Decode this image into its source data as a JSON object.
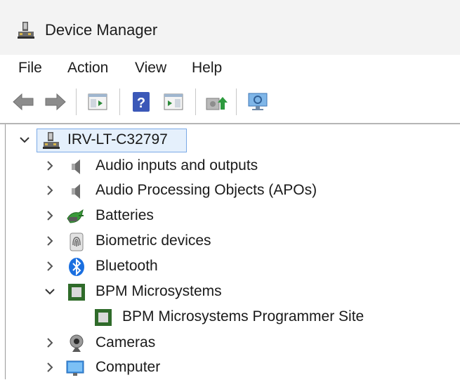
{
  "window": {
    "title": "Device Manager"
  },
  "menu": [
    "File",
    "Action",
    "View",
    "Help"
  ],
  "toolbar": {
    "icons": [
      "back-arrow-icon",
      "forward-arrow-icon",
      "show-hide-console-tree-icon",
      "help-icon",
      "action-pane-icon",
      "update-driver-icon",
      "scan-hardware-changes-icon"
    ]
  },
  "tree": {
    "root": {
      "label": "IRV-LT-C32797",
      "expanded": true,
      "selected": true
    },
    "items": [
      {
        "label": "Audio inputs and outputs",
        "icon": "speaker-icon",
        "expanded": false
      },
      {
        "label": "Audio Processing Objects (APOs)",
        "icon": "speaker-icon",
        "expanded": false
      },
      {
        "label": "Batteries",
        "icon": "battery-icon",
        "expanded": false
      },
      {
        "label": "Biometric devices",
        "icon": "fingerprint-icon",
        "expanded": false
      },
      {
        "label": "Bluetooth",
        "icon": "bluetooth-icon",
        "expanded": false
      },
      {
        "label": "BPM Microsystems",
        "icon": "chip-icon",
        "expanded": true,
        "children": [
          {
            "label": "BPM Microsystems Programmer Site",
            "icon": "chip-icon"
          }
        ]
      },
      {
        "label": "Cameras",
        "icon": "webcam-icon",
        "expanded": false
      },
      {
        "label": "Computer",
        "icon": "monitor-icon",
        "expanded": false
      }
    ]
  },
  "colors": {
    "titlebar": "#f3f3f3",
    "selection_border": "#7aa9e6",
    "selection_fill": "#e5f0fc",
    "chip_green": "#2f6b2a",
    "bluetooth_blue": "#1a6fe0"
  }
}
